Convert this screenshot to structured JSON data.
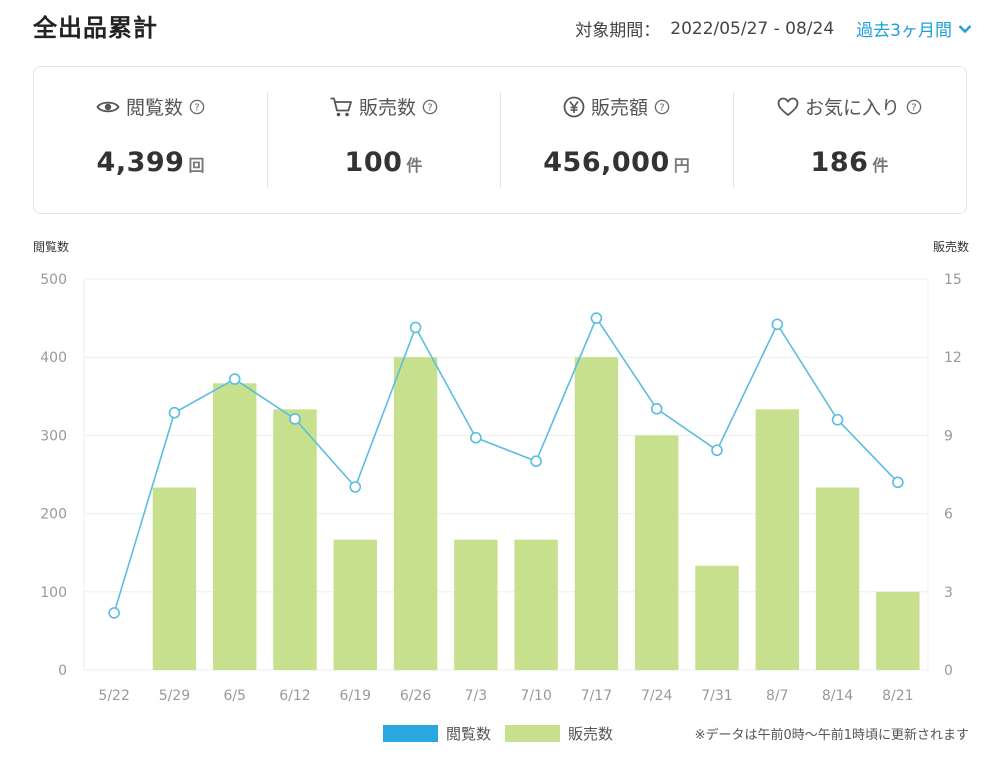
{
  "header": {
    "title": "全出品累計",
    "period_label": "対象期間：",
    "period_range": "2022/05/27 - 08/24",
    "period_select": "過去3ヶ月間"
  },
  "stats": [
    {
      "icon": "eye-icon",
      "label": "閲覧数",
      "value": "4,399",
      "unit": "回"
    },
    {
      "icon": "cart-icon",
      "label": "販売数",
      "value": "100",
      "unit": "件"
    },
    {
      "icon": "yen-icon",
      "label": "販売額",
      "value": "456,000",
      "unit": "円"
    },
    {
      "icon": "heart-icon",
      "label": "お気に入り",
      "value": "186",
      "unit": "件"
    }
  ],
  "colors": {
    "accent": "#1fa0d8",
    "line": "#5bbde0",
    "bar": "#c7e08e",
    "legend_views": "#29a8e0",
    "legend_sales": "#c7e08e"
  },
  "note": "※データは午前0時～午前1時頃に更新されます",
  "chart_data": {
    "type": "bar",
    "categories": [
      "5/22",
      "5/29",
      "6/5",
      "6/12",
      "6/19",
      "6/26",
      "7/3",
      "7/10",
      "7/17",
      "7/24",
      "7/31",
      "8/7",
      "8/14",
      "8/21"
    ],
    "series": [
      {
        "name": "閲覧数",
        "type": "line",
        "axis": "left",
        "values": [
          73,
          329,
          372,
          321,
          234,
          438,
          297,
          267,
          450,
          334,
          281,
          442,
          320,
          240
        ]
      },
      {
        "name": "販売数",
        "type": "bar",
        "axis": "right",
        "values": [
          0,
          7,
          11,
          10,
          5,
          12,
          5,
          5,
          12,
          9,
          4,
          10,
          7,
          3
        ]
      }
    ],
    "ylabel": "閲覧数",
    "y2label": "販売数",
    "ylim": [
      0,
      500
    ],
    "yticks": [
      0,
      100,
      200,
      300,
      400,
      500
    ],
    "y2lim": [
      0,
      15
    ],
    "y2ticks": [
      0,
      3,
      6,
      9,
      12,
      15
    ],
    "grid": true,
    "legend": "bottom-center"
  }
}
